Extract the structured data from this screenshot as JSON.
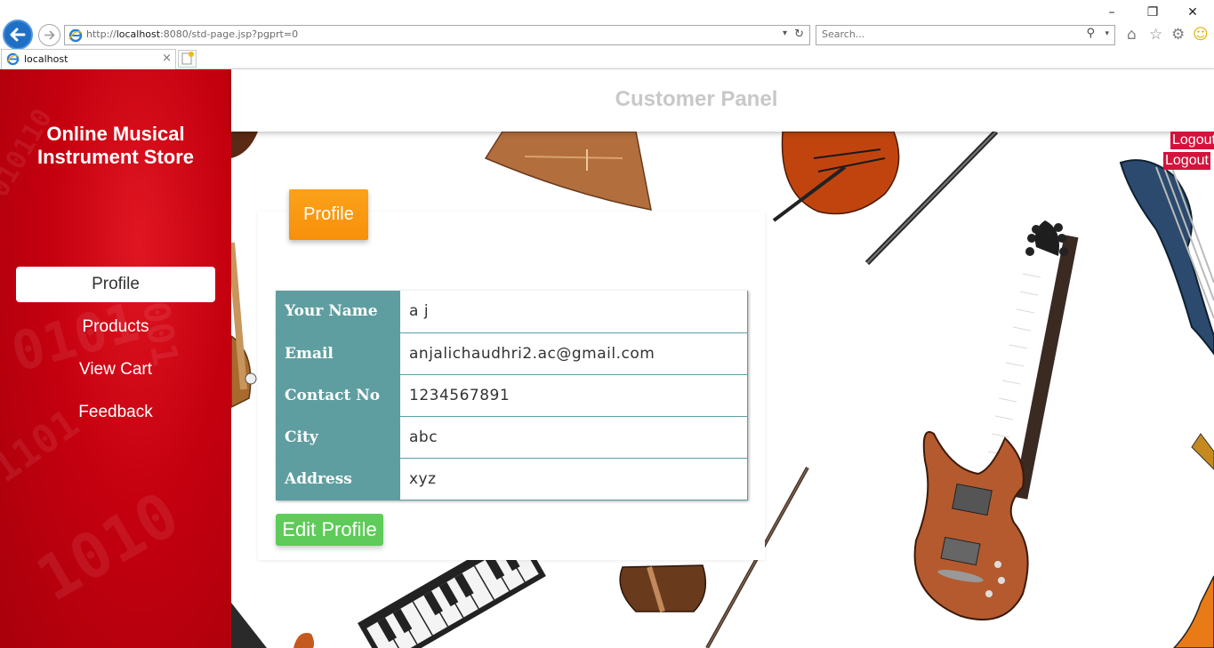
{
  "browser": {
    "url_prefix": "http://",
    "url_host": "localhost",
    "url_rest": ":8080/std-page.jsp?pgprt=0",
    "search_placeholder": "Search...",
    "tab_title": "localhost",
    "minimize": "–",
    "restore": "❐",
    "close": "✕"
  },
  "sidebar": {
    "site_title_line1": "Online Musical",
    "site_title_line2": "Instrument Store",
    "items": [
      {
        "label": "Profile",
        "active": true
      },
      {
        "label": "Products",
        "active": false
      },
      {
        "label": "View Cart",
        "active": false
      },
      {
        "label": "Feedback",
        "active": false
      }
    ]
  },
  "header": {
    "title": "Customer Panel"
  },
  "logout": {
    "label_1": "Logout",
    "label_2": "Logout"
  },
  "profile_card": {
    "tag": "Profile",
    "rows": [
      {
        "label": "Your Name",
        "value": "a j"
      },
      {
        "label": "Email",
        "value": "anjalichaudhri2.ac@gmail.com"
      },
      {
        "label": "Contact No",
        "value": "1234567891"
      },
      {
        "label": "City",
        "value": "abc"
      },
      {
        "label": "Address",
        "value": "xyz"
      }
    ],
    "edit_button": "Edit Profile"
  },
  "colors": {
    "sidebar_red": "#c5000f",
    "table_label_bg": "#5f9ea0",
    "tag_orange": "#f7900b",
    "edit_green": "#5fcb5a",
    "logout_red": "#d4133d"
  }
}
